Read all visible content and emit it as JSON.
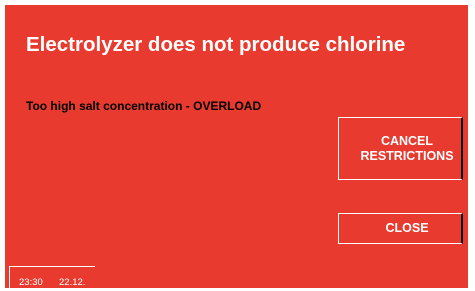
{
  "dialog": {
    "title": "Electrolyzer does not produce chlorine",
    "message": "Too high salt concentration - OVERLOAD",
    "cancel_label": "CANCEL RESTRICTIONS",
    "close_label": "CLOSE"
  },
  "status": {
    "time": "23:30",
    "date": "22.12."
  },
  "colors": {
    "panel_background": "#e83a2e",
    "title_text": "#ffffff",
    "message_text": "#000000",
    "button_outline": "#ffffff"
  }
}
